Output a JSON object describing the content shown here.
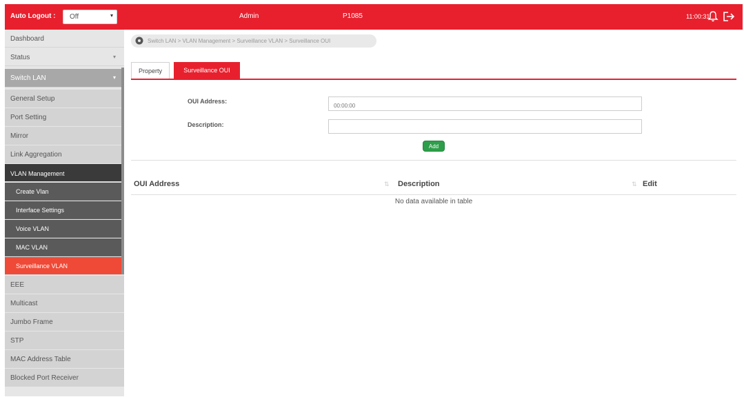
{
  "topbar": {
    "auto_logout_label": "Auto Logout :",
    "auto_logout_value": "Off",
    "user": "Admin",
    "model": "P1085",
    "clock": "11:00:31",
    "bell_icon": "bell-icon",
    "logout_icon": "logout-icon"
  },
  "sidebar": {
    "items": [
      {
        "label": "Dashboard"
      },
      {
        "label": "Status"
      },
      {
        "label": "Switch LAN"
      },
      {
        "label": "General Setup"
      },
      {
        "label": "Port Setting"
      },
      {
        "label": "Mirror"
      },
      {
        "label": "Link Aggregation"
      },
      {
        "label": "VLAN Management"
      },
      {
        "label": "Create Vlan"
      },
      {
        "label": "Interface Settings"
      },
      {
        "label": "Voice VLAN"
      },
      {
        "label": "MAC VLAN"
      },
      {
        "label": "Surveillance VLAN"
      },
      {
        "label": "EEE"
      },
      {
        "label": "Multicast"
      },
      {
        "label": "Jumbo Frame"
      },
      {
        "label": "STP"
      },
      {
        "label": "MAC Address Table"
      },
      {
        "label": "Blocked Port Receiver"
      }
    ]
  },
  "breadcrumb": {
    "text": "Switch LAN > VLAN Management > Surveillance VLAN > Surveillance OUI",
    "icon": "location-pin-icon"
  },
  "tabs": [
    {
      "label": "Property"
    },
    {
      "label": "Surveillance OUI"
    }
  ],
  "form": {
    "oui_label": "OUI Address:",
    "oui_placeholder": "00:00:00",
    "desc_label": "Description:",
    "add_label": "Add"
  },
  "table": {
    "headers": [
      "OUI Address",
      "Description",
      "Edit"
    ],
    "empty_text": "No data available in table"
  },
  "colors": {
    "brand_red": "#e8202e",
    "active_item": "#ef4a37",
    "add_green": "#2e9e4a"
  }
}
